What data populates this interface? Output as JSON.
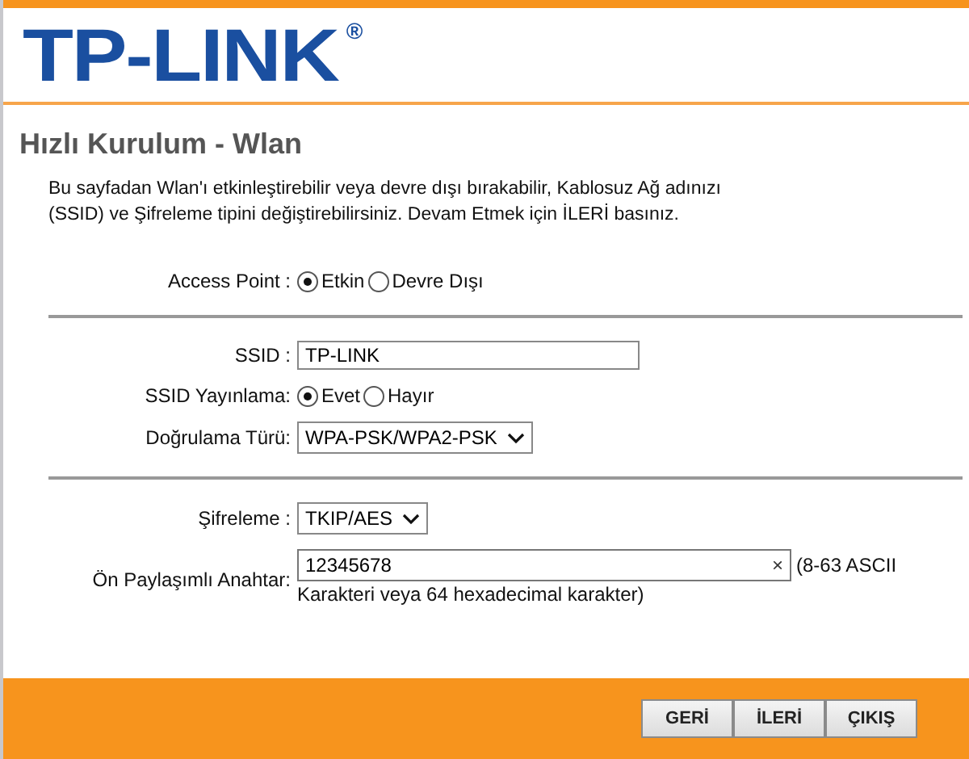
{
  "logo": {
    "name": "TP-LINK",
    "mark": "®"
  },
  "title": "Hızlı Kurulum - Wlan",
  "description": "Bu sayfadan Wlan'ı etkinleştirebilir veya devre dışı bırakabilir, Kablosuz Ağ adınızı (SSID) ve Şifreleme tipini değiştirebilirsiniz. Devam Etmek için İLERİ basınız.",
  "sections": [
    {
      "rows": [
        {
          "kind": "radio",
          "label": "Access Point :",
          "options": [
            {
              "label": "Etkin",
              "selected": true
            },
            {
              "label": "Devre Dışı",
              "selected": false
            }
          ]
        }
      ]
    },
    {
      "rows": [
        {
          "kind": "text",
          "label": "SSID :",
          "value": "TP-LINK"
        },
        {
          "kind": "radio",
          "label": "SSID Yayınlama:",
          "options": [
            {
              "label": "Evet",
              "selected": true
            },
            {
              "label": "Hayır",
              "selected": false
            }
          ]
        },
        {
          "kind": "select",
          "label": "Doğrulama Türü:",
          "value": "WPA-PSK/WPA2-PSK"
        }
      ]
    },
    {
      "rows": [
        {
          "kind": "select",
          "label": "Şifreleme :",
          "value": "TKIP/AES"
        },
        {
          "kind": "key",
          "label": "Ön Paylaşımlı Anahtar:",
          "value": "12345678",
          "clear": "×",
          "hint": [
            "(8-63 ASCII",
            "Karakteri veya 64 hexadecimal karakter)"
          ]
        }
      ]
    }
  ],
  "buttons": [
    "GERİ",
    "İLERİ",
    "ÇIKIŞ"
  ]
}
